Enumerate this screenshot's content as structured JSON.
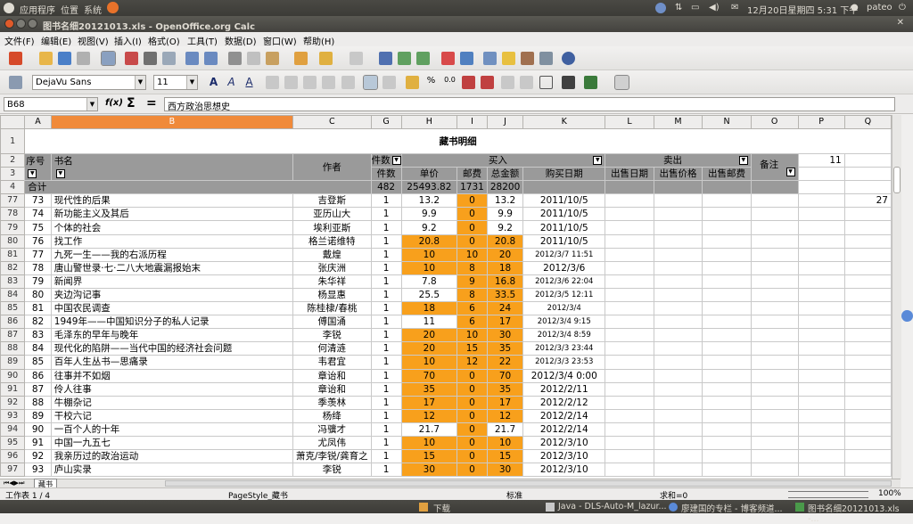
{
  "topbar": {
    "apps": "应用程序",
    "places": "位置",
    "system": "系统",
    "datetime": "12月20日星期四 5:31 下午",
    "user": "pateo"
  },
  "window": {
    "title": "图书名细20121013.xls - OpenOffice.org Calc"
  },
  "menu": [
    "文件(F)",
    "编辑(E)",
    "视图(V)",
    "插入(I)",
    "格式(O)",
    "工具(T)",
    "数据(D)",
    "窗口(W)",
    "帮助(H)"
  ],
  "format": {
    "font": "DejaVu Sans",
    "size": "11"
  },
  "formula": {
    "cell_ref": "B68",
    "fx": "f(x)",
    "sum": "Σ",
    "eq": "=",
    "content": "西方政治思想史"
  },
  "columns": [
    "A",
    "B",
    "C",
    "G",
    "H",
    "I",
    "J",
    "K",
    "L",
    "M",
    "N",
    "O",
    "P",
    "Q"
  ],
  "header": {
    "r1": "藏书明细",
    "r2_count": "件数",
    "r2_buy": "买入",
    "r2_sell": "卖出",
    "r2_note": "备注",
    "p2": "11",
    "seq": "序号",
    "name": "书名",
    "author": "作者",
    "r3": [
      "件数",
      "单价",
      "邮费",
      "总金额",
      "购买日期",
      "出售日期",
      "出售价格",
      "出售邮费"
    ],
    "r4_label": "合计",
    "r4": [
      "482",
      "25493.82",
      "1731",
      "28200"
    ]
  },
  "rows": [
    {
      "r": "77",
      "a": "73",
      "b": "现代性的后果",
      "c": "吉登斯",
      "g": "1",
      "h": "13.2",
      "i": "0",
      "j": "13.2",
      "k": "2011/10/5",
      "ho": false,
      "io": true,
      "jo": false,
      "ks": false,
      "q": "27"
    },
    {
      "r": "78",
      "a": "74",
      "b": "新功能主义及其后",
      "c": "亚历山大",
      "g": "1",
      "h": "9.9",
      "i": "0",
      "j": "9.9",
      "k": "2011/10/5",
      "ho": false,
      "io": true,
      "jo": false,
      "ks": false,
      "q": ""
    },
    {
      "r": "79",
      "a": "75",
      "b": "个体的社会",
      "c": "埃利亚斯",
      "g": "1",
      "h": "9.2",
      "i": "0",
      "j": "9.2",
      "k": "2011/10/5",
      "ho": false,
      "io": true,
      "jo": false,
      "ks": false,
      "q": ""
    },
    {
      "r": "80",
      "a": "76",
      "b": "找工作",
      "c": "格兰诺维特",
      "g": "1",
      "h": "20.8",
      "i": "0",
      "j": "20.8",
      "k": "2011/10/5",
      "ho": true,
      "io": true,
      "jo": true,
      "ks": false,
      "q": ""
    },
    {
      "r": "81",
      "a": "77",
      "b": "九死一生——我的右派历程",
      "c": "戴煌",
      "g": "1",
      "h": "10",
      "i": "10",
      "j": "20",
      "k": "2012/3/7 11:51",
      "ho": true,
      "io": true,
      "jo": true,
      "ks": true,
      "q": ""
    },
    {
      "r": "82",
      "a": "78",
      "b": "唐山警世录·七·二八大地震漏报始末",
      "c": "张庆洲",
      "g": "1",
      "h": "10",
      "i": "8",
      "j": "18",
      "k": "2012/3/6",
      "ho": true,
      "io": true,
      "jo": true,
      "ks": false,
      "q": ""
    },
    {
      "r": "83",
      "a": "79",
      "b": "新闻界",
      "c": "朱华祥",
      "g": "1",
      "h": "7.8",
      "i": "9",
      "j": "16.8",
      "k": "2012/3/6 22:04",
      "ho": false,
      "io": true,
      "jo": true,
      "ks": true,
      "q": ""
    },
    {
      "r": "84",
      "a": "80",
      "b": "夹边沟记事",
      "c": "杨显惠",
      "g": "1",
      "h": "25.5",
      "i": "8",
      "j": "33.5",
      "k": "2012/3/5 12:11",
      "ho": false,
      "io": true,
      "jo": true,
      "ks": true,
      "q": ""
    },
    {
      "r": "85",
      "a": "81",
      "b": "中国农民调查",
      "c": "陈桂棣/春桃",
      "g": "1",
      "h": "18",
      "i": "6",
      "j": "24",
      "k": "2012/3/4",
      "ho": true,
      "io": true,
      "jo": true,
      "ks": true,
      "q": ""
    },
    {
      "r": "86",
      "a": "82",
      "b": "1949年——中国知识分子的私人记录",
      "c": "傅国涌",
      "g": "1",
      "h": "11",
      "i": "6",
      "j": "17",
      "k": "2012/3/4 9:15",
      "ho": false,
      "io": true,
      "jo": true,
      "ks": true,
      "q": ""
    },
    {
      "r": "87",
      "a": "83",
      "b": "毛泽东的早年与晚年",
      "c": "李锐",
      "g": "1",
      "h": "20",
      "i": "10",
      "j": "30",
      "k": "2012/3/4 8:59",
      "ho": true,
      "io": true,
      "jo": true,
      "ks": true,
      "q": ""
    },
    {
      "r": "88",
      "a": "84",
      "b": "现代化的陷阱——当代中国的经济社会问题",
      "c": "何清涟",
      "g": "1",
      "h": "20",
      "i": "15",
      "j": "35",
      "k": "2012/3/3 23:44",
      "ho": true,
      "io": true,
      "jo": true,
      "ks": true,
      "q": ""
    },
    {
      "r": "89",
      "a": "85",
      "b": "百年人生丛书—思痛录",
      "c": "韦君宜",
      "g": "1",
      "h": "10",
      "i": "12",
      "j": "22",
      "k": "2012/3/3 23:53",
      "ho": true,
      "io": true,
      "jo": true,
      "ks": true,
      "q": ""
    },
    {
      "r": "90",
      "a": "86",
      "b": "往事并不如烟",
      "c": "章诒和",
      "g": "1",
      "h": "70",
      "i": "0",
      "j": "70",
      "k": "2012/3/4 0:00",
      "ho": true,
      "io": true,
      "jo": true,
      "ks": false,
      "q": ""
    },
    {
      "r": "91",
      "a": "87",
      "b": "伶人往事",
      "c": "章诒和",
      "g": "1",
      "h": "35",
      "i": "0",
      "j": "35",
      "k": "2012/2/11",
      "ho": true,
      "io": true,
      "jo": true,
      "ks": false,
      "q": ""
    },
    {
      "r": "92",
      "a": "88",
      "b": "牛棚杂记",
      "c": "季羡林",
      "g": "1",
      "h": "17",
      "i": "0",
      "j": "17",
      "k": "2012/2/12",
      "ho": true,
      "io": true,
      "jo": true,
      "ks": false,
      "q": ""
    },
    {
      "r": "93",
      "a": "89",
      "b": "干校六记",
      "c": "杨绛",
      "g": "1",
      "h": "12",
      "i": "0",
      "j": "12",
      "k": "2012/2/14",
      "ho": true,
      "io": true,
      "jo": true,
      "ks": false,
      "q": ""
    },
    {
      "r": "94",
      "a": "90",
      "b": "一百个人的十年",
      "c": "冯骥才",
      "g": "1",
      "h": "21.7",
      "i": "0",
      "j": "21.7",
      "k": "2012/2/14",
      "ho": false,
      "io": true,
      "jo": false,
      "ks": false,
      "q": ""
    },
    {
      "r": "95",
      "a": "91",
      "b": "中国一九五七",
      "c": "尤凤伟",
      "g": "1",
      "h": "10",
      "i": "0",
      "j": "10",
      "k": "2012/3/10",
      "ho": true,
      "io": true,
      "jo": true,
      "ks": false,
      "q": ""
    },
    {
      "r": "96",
      "a": "92",
      "b": "我亲历过的政治运动",
      "c": "萧克/李锐/龚育之",
      "g": "1",
      "h": "15",
      "i": "0",
      "j": "15",
      "k": "2012/3/10",
      "ho": true,
      "io": true,
      "jo": true,
      "ks": false,
      "q": ""
    },
    {
      "r": "97",
      "a": "93",
      "b": "庐山实录",
      "c": "李锐",
      "g": "1",
      "h": "30",
      "i": "0",
      "j": "30",
      "k": "2012/3/10",
      "ho": true,
      "io": true,
      "jo": true,
      "ks": false,
      "q": ""
    }
  ],
  "tabs": [
    "藏书"
  ],
  "status": {
    "sheet": "工作表 1 / 4",
    "pagestyle": "PageStyle_藏书",
    "mode": "标准",
    "sum": "求和=0",
    "zoom": "100%"
  },
  "taskbar": {
    "t1": "下载",
    "t2": "Java - DLS-Auto-M_lazur...",
    "t3": "廖建国的专栏 - 博客频道...",
    "t4": "图书名细20121013.xls -..."
  }
}
